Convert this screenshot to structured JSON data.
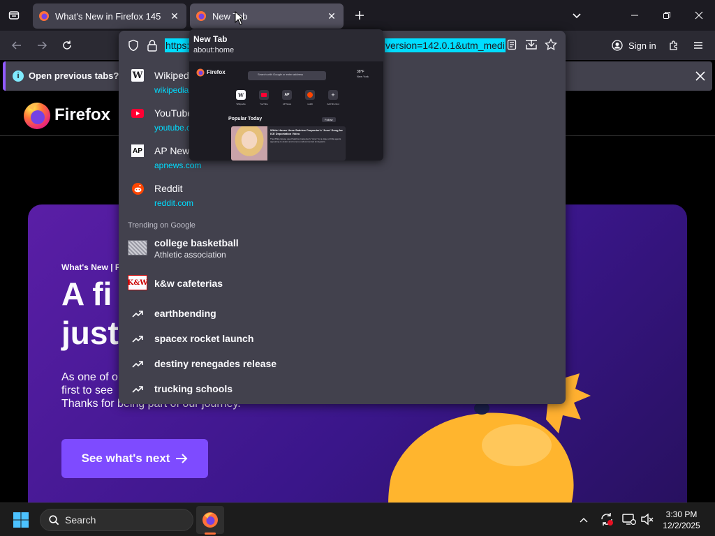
{
  "tabs": [
    {
      "title": "What's New in Firefox 145",
      "active": false
    },
    {
      "title": "New Tab",
      "active": true
    }
  ],
  "toolbar": {
    "url_visible_start": "https:",
    "url_visible_end": "version=142.0.1&utm_medi",
    "sign_in_label": "Sign in"
  },
  "infobar": {
    "message": "Open previous tabs? You"
  },
  "tab_preview": {
    "title": "New Tab",
    "url": "about:home",
    "mini_brand": "Firefox",
    "mini_search_placeholder": "Search with Google or enter address",
    "mini_shortcuts": [
      "Wikipedia",
      "YouTube",
      "AP News",
      "reddit",
      "Add Shortcut"
    ],
    "mini_section": "Popular Today",
    "mini_follow": "Follow",
    "mini_article_title": "White House Uses Sabrina Carpenter's 'Juno' Song for ICE Deportation Video",
    "mini_article_body": "The White House used Sabrina Carpenter's \"Juno\" for a video of ICE agents appearing to detain and remove undocumented immigrants.",
    "mini_weather": "38°F",
    "mini_weather_loc": "New York"
  },
  "suggestions": [
    {
      "title": "Wikipedia",
      "url": "wikipedia.org",
      "icon": "wikipedia-icon"
    },
    {
      "title": "YouTube",
      "url": "youtube.com",
      "icon": "youtube-icon"
    },
    {
      "title": "AP News",
      "url": "apnews.com",
      "icon": "ap-news-icon"
    },
    {
      "title": "Reddit",
      "url": "reddit.com",
      "icon": "reddit-icon"
    }
  ],
  "trending": {
    "header": "Trending on Google",
    "items": [
      {
        "title": "college basketball",
        "subtitle": "Athletic association",
        "icon": "basketball-thumbnail"
      },
      {
        "title": "k&w cafeterias",
        "subtitle": "",
        "icon": "kw-logo-thumbnail"
      },
      {
        "title": "earthbending",
        "subtitle": "",
        "icon": "trending-icon"
      },
      {
        "title": "spacex rocket launch",
        "subtitle": "",
        "icon": "trending-icon"
      },
      {
        "title": "destiny renegades release",
        "subtitle": "",
        "icon": "trending-icon"
      },
      {
        "title": "trucking schools",
        "subtitle": "",
        "icon": "trending-icon"
      }
    ]
  },
  "page": {
    "brand": "Firefox",
    "eyebrow": "What's New | F",
    "headline_line1": "A fi",
    "headline_line2": "just",
    "body_line1": "As one of o",
    "body_line2": "first to see",
    "body_line3": "Thanks for being part of our journey.",
    "cta_label": "See what's next"
  },
  "taskbar": {
    "search_placeholder": "Search",
    "time": "3:30 PM",
    "date": "12/2/2025"
  },
  "colors": {
    "accent": "#9059ff",
    "link": "#00ddff",
    "dropdown_bg": "#42414d",
    "toolbar_bg": "#2b2a33",
    "tabstrip_bg": "#1c1b22"
  }
}
